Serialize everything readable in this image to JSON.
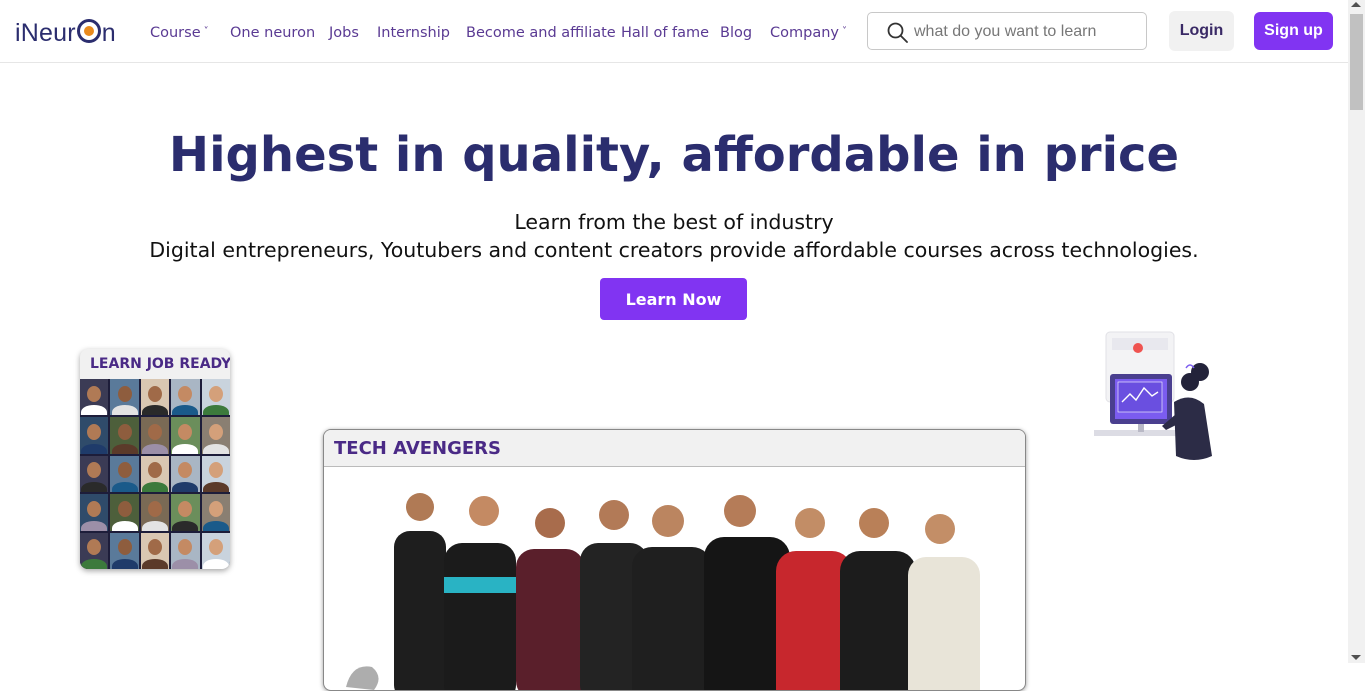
{
  "nav": {
    "logo_prefix": "iNeur",
    "logo_suffix": "n",
    "items": [
      {
        "label": "Course",
        "dropdown": true
      },
      {
        "label": "One neuron",
        "dropdown": false
      },
      {
        "label": "Jobs",
        "dropdown": false
      },
      {
        "label": "Internship",
        "dropdown": false
      },
      {
        "label": "Become and affiliate",
        "dropdown": false
      },
      {
        "label": "Hall of fame",
        "dropdown": false
      },
      {
        "label": "Blog",
        "dropdown": false
      },
      {
        "label": "Company",
        "dropdown": true
      }
    ],
    "caret": "˅",
    "search_placeholder": "what do you want to learn",
    "search_icon": "search-icon",
    "login_label": "Login",
    "signup_label": "Sign up"
  },
  "hero": {
    "title": "Highest in quality, affordable in price",
    "subtitle_line1": "Learn from the best of industry",
    "subtitle_line2": "Digital entrepreneurs, Youtubers and content creators provide affordable courses across technologies.",
    "cta_label": "Learn Now"
  },
  "learn_job_ready": {
    "title": "LEARN JOB READY"
  },
  "tech_avengers": {
    "title": "TECH AVENGERS"
  },
  "colors": {
    "brand_navy": "#2b2d6e",
    "accent_purple": "#8134f2",
    "nav_text": "#5a3a93",
    "card_title": "#4a2a86",
    "logo_orange": "#e98a1d"
  }
}
